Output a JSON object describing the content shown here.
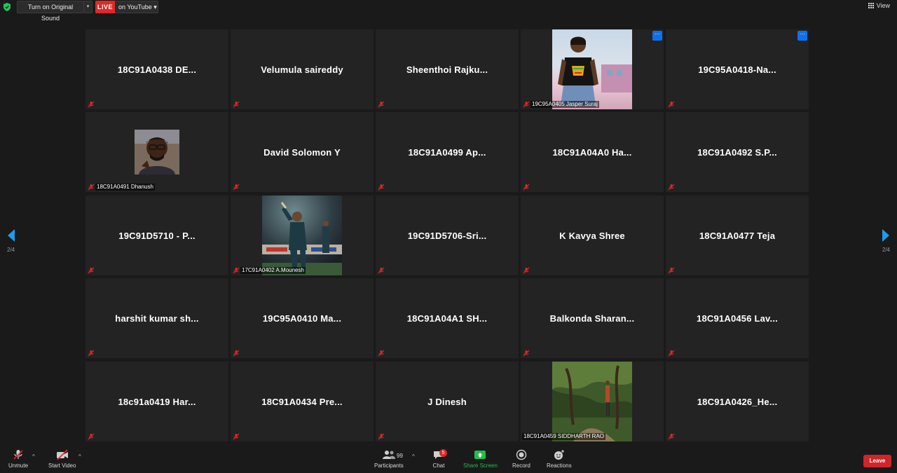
{
  "topbar": {
    "original_sound_label": "Turn on Original Sound",
    "live_label": "LIVE",
    "live_on_label": "on YouTube",
    "view_label": "View"
  },
  "pager": {
    "left_page": "2/4",
    "right_page": "2/4"
  },
  "tiles": [
    {
      "big": "18C91A0438 DE...",
      "label": ""
    },
    {
      "big": "Velumula saireddy",
      "label": ""
    },
    {
      "big": "Sheenthoi  Rajku...",
      "label": ""
    },
    {
      "big": "",
      "label": "19C95A0405 Jasper Suraj"
    },
    {
      "big": "19C95A0418-Na...",
      "label": ""
    },
    {
      "big": "",
      "label": "18C91A0491 Dhanush"
    },
    {
      "big": "David Solomon Y",
      "label": ""
    },
    {
      "big": "18C91A0499 Ap...",
      "label": ""
    },
    {
      "big": "18C91A04A0  Ha...",
      "label": ""
    },
    {
      "big": "18C91A0492 S.P...",
      "label": ""
    },
    {
      "big": "19C91D5710 - P...",
      "label": ""
    },
    {
      "big": "",
      "label": "17C91A0402 A.Mounesh"
    },
    {
      "big": "19C91D5706-Sri...",
      "label": ""
    },
    {
      "big": "K Kavya Shree",
      "label": ""
    },
    {
      "big": "18C91A0477 Teja",
      "label": ""
    },
    {
      "big": "harshit  kumar sh...",
      "label": ""
    },
    {
      "big": "19C95A0410 Ma...",
      "label": ""
    },
    {
      "big": "18C91A04A1  SH...",
      "label": ""
    },
    {
      "big": "Balkonda  Sharan...",
      "label": ""
    },
    {
      "big": "18C91A0456  Lav...",
      "label": ""
    },
    {
      "big": "18c91a0419 Har...",
      "label": ""
    },
    {
      "big": "18C91A0434  Pre...",
      "label": ""
    },
    {
      "big": "J Dinesh",
      "label": ""
    },
    {
      "big": "",
      "label": "18C91A0459 SIDDHARTH RAO"
    },
    {
      "big": "18C91A0426_He...",
      "label": ""
    }
  ],
  "toolbar": {
    "unmute_label": "Unmute",
    "start_video_label": "Start Video",
    "participants_label": "Participants",
    "participants_count": "99",
    "chat_label": "Chat",
    "chat_badge": "5",
    "share_screen_label": "Share Screen",
    "record_label": "Record",
    "reactions_label": "Reactions",
    "leave_label": "Leave"
  },
  "colors": {
    "accent_blue": "#0e71eb",
    "live_red": "#e02828",
    "share_green": "#1fbf4c",
    "leave_red": "#d1252a",
    "tile_bg": "#232323"
  }
}
